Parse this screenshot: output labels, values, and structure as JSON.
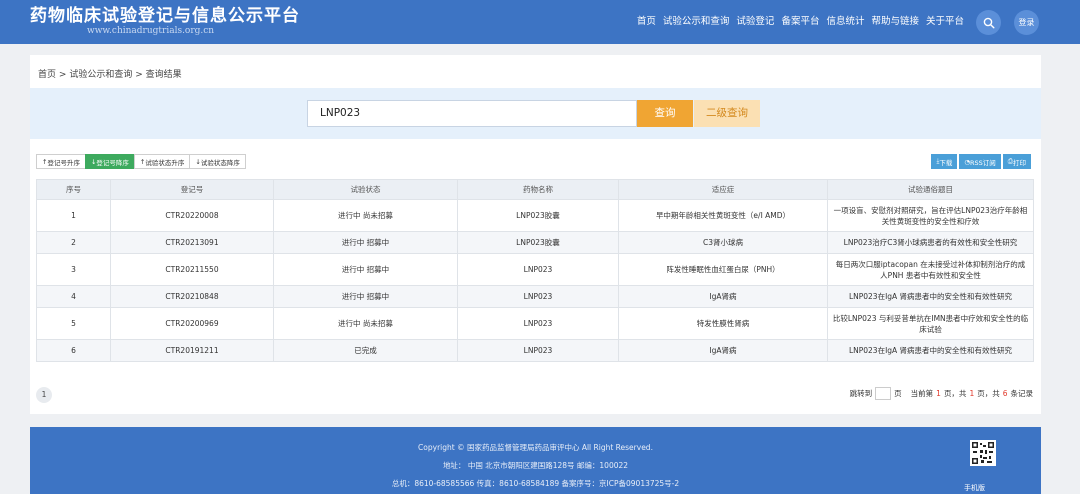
{
  "header": {
    "title": "药物临床试验登记与信息公示平台",
    "url": "www.chinadrugtrials.org.cn",
    "nav": [
      "首页",
      "试验公示和查询",
      "试验登记",
      "备案平台",
      "信息统计",
      "帮助与链接",
      "关于平台"
    ],
    "login": "登录"
  },
  "breadcrumb": [
    "首页",
    ">",
    "试验公示和查询",
    ">",
    "查询结果"
  ],
  "search": {
    "value": "LNP023",
    "query_label": "查询",
    "advanced_label": "二级查询"
  },
  "sort_buttons": [
    {
      "label": "登记号升序",
      "icon": "↑",
      "active": false
    },
    {
      "label": "登记号降序",
      "icon": "↓",
      "active": true
    },
    {
      "label": "试验状态升序",
      "icon": "↑",
      "active": false
    },
    {
      "label": "试验状态降序",
      "icon": "↓",
      "active": false
    }
  ],
  "tools": [
    {
      "label": "下载",
      "icon": "⤓"
    },
    {
      "label": "RSS订阅",
      "icon": "◔"
    },
    {
      "label": "打印",
      "icon": "⎙"
    }
  ],
  "table": {
    "headers": [
      "序号",
      "登记号",
      "试验状态",
      "药物名称",
      "适应症",
      "试验通俗题目"
    ],
    "rows": [
      [
        "1",
        "CTR20220008",
        "进行中 尚未招募",
        "LNP023胶囊",
        "早中期年龄相关性黄斑变性（e/I AMD）",
        "一项设盲、安慰剂对照研究，旨在评估LNP023治疗年龄相关性黄斑变性的安全性和疗效"
      ],
      [
        "2",
        "CTR20213091",
        "进行中 招募中",
        "LNP023胶囊",
        "C3肾小球病",
        "LNP023治疗C3肾小球病患者的有效性和安全性研究"
      ],
      [
        "3",
        "CTR20211550",
        "进行中 招募中",
        "LNP023",
        "阵发性睡眠性血红蛋白尿（PNH）",
        "每日两次口服iptacopan 在未接受过补体抑制剂治疗的成人PNH 患者中有效性和安全性"
      ],
      [
        "4",
        "CTR20210848",
        "进行中 招募中",
        "LNP023",
        "IgA肾病",
        "LNP023在IgA 肾病患者中的安全性和有效性研究"
      ],
      [
        "5",
        "CTR20200969",
        "进行中 尚未招募",
        "LNP023",
        "特发性膜性肾病",
        "比较LNP023 与利妥昔单抗在IMN患者中疗效和安全性的临床试验"
      ],
      [
        "6",
        "CTR20191211",
        "已完成",
        "LNP023",
        "IgA肾病",
        "LNP023在IgA 肾病患者中的安全性和有效性研究"
      ]
    ]
  },
  "pagination": {
    "page": "1",
    "jump_prefix": "跳转到",
    "jump_suffix": "页",
    "current_prefix": "当前第",
    "current": "1",
    "total_prefix": "页，共",
    "total_pages": "1",
    "count_prefix": "页，共",
    "total_records": "6",
    "count_suffix": "条记录"
  },
  "footer": {
    "copyright": "Copyright © 国家药品监督管理局药品审评中心 All Right Reserved.",
    "address": "地址： 中国 北京市朝阳区建国路128号 邮编：100022",
    "contact": "总机：8610-68585566 传真：8610-68584189 备案序号：京ICP备09013725号-2",
    "qr_label": "手机版"
  },
  "colors": {
    "brand_blue": "#3d74c4",
    "query_orange": "#f0a533",
    "active_green": "#3daa5e",
    "tool_blue": "#4a9fd8"
  }
}
